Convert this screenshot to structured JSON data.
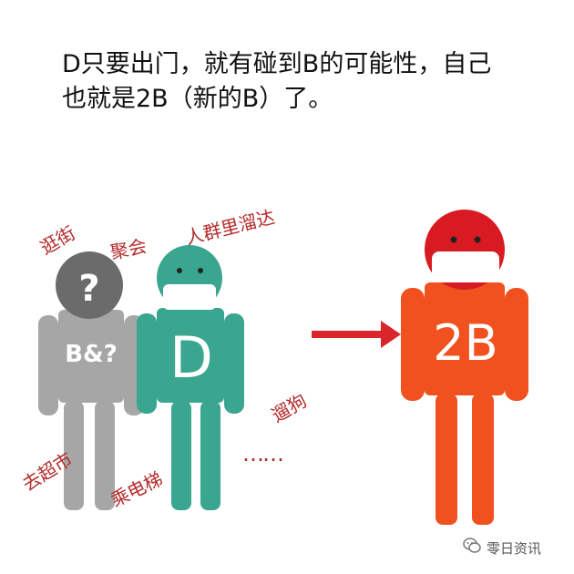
{
  "headline": {
    "line1": "D只要出门，就有碰到B的可能性，自己",
    "line2": "也就是2B（新的B）了。"
  },
  "activities": {
    "shopping_street": "逛街",
    "gathering": "聚会",
    "crowd": "人群里溜达",
    "dog_walking": "遛狗",
    "supermarket": "去超市",
    "elevator": "乘电梯",
    "ellipsis": "……"
  },
  "figures": {
    "unknown": {
      "head_mark": "?",
      "body_text": "B&?",
      "color": "#a7a6a6",
      "head_color": "#6b6b6b"
    },
    "d": {
      "body_text": "D",
      "color": "#3aa68f",
      "head_color": "#3aa68f",
      "mask_color": "#ffffff"
    },
    "two_b": {
      "body_text": "2B",
      "color": "#f0511f",
      "head_color": "#d81b22",
      "mask_color": "#ffffff"
    }
  },
  "arrow_color": "#d8262a",
  "watermark": {
    "icon": "wechat-icon",
    "text": "零日资讯"
  }
}
